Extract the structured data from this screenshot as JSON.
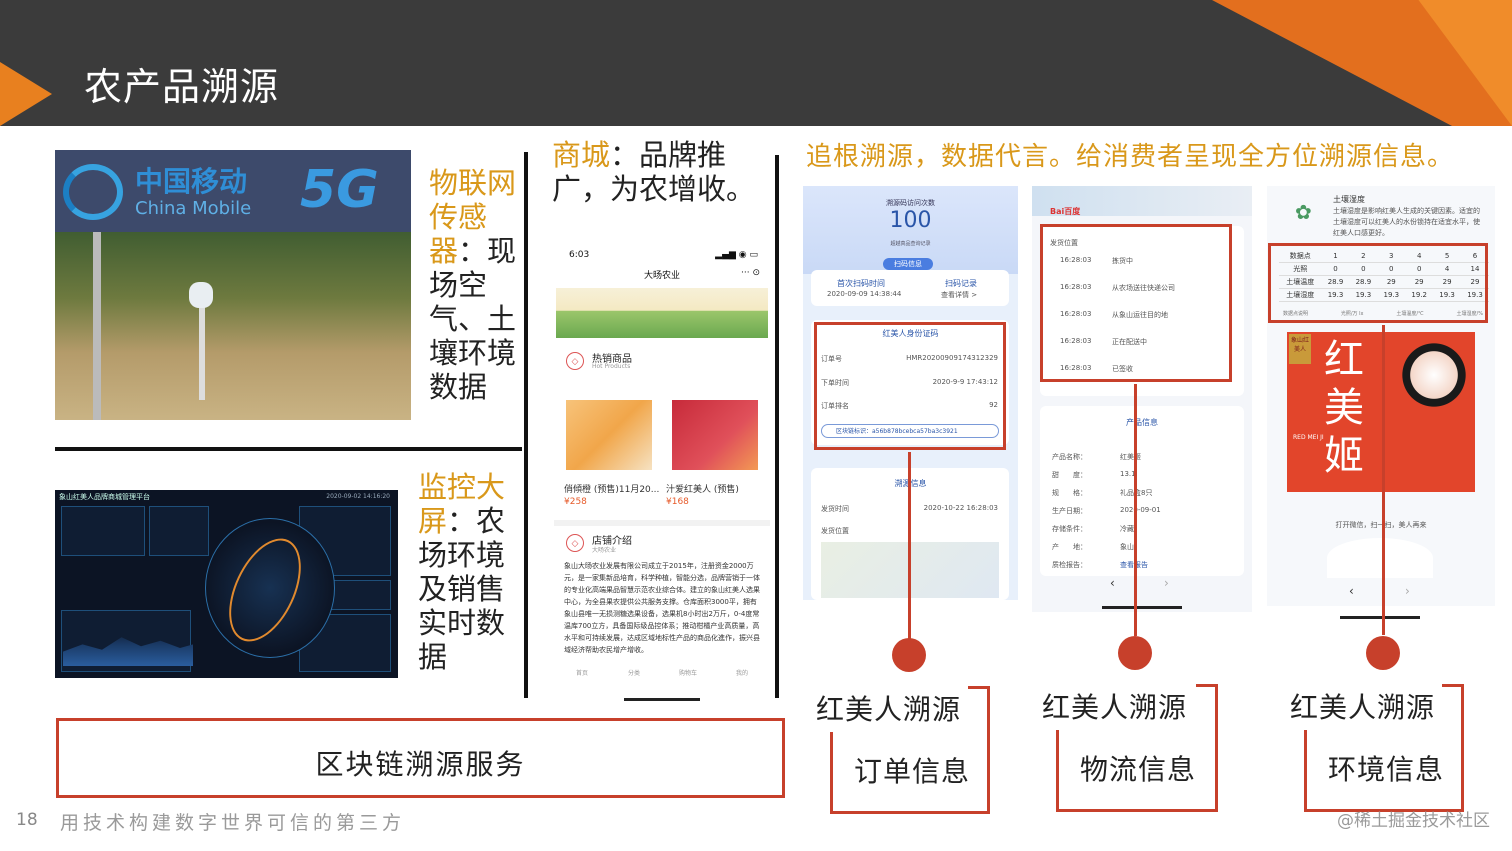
{
  "header": {
    "title": "农产品溯源"
  },
  "logo": {
    "cn": "中国移动",
    "en": "China Mobile",
    "badge": "5G"
  },
  "iot": {
    "highlight": "物联网传感器",
    "text": "：现场空气、土壤环境数据"
  },
  "monitor": {
    "highlight": "监控大屏",
    "text": "：农场环境及销售实时数据",
    "dashboard_title": "象山红美人品牌商城管理平台",
    "dashboard_time": "2020-09-02 14:16:20"
  },
  "mall": {
    "highlight": "商城",
    "text": "：品牌推广，为农增收。"
  },
  "phone": {
    "time": "6:03",
    "app_name": "大旸农业",
    "hot_title": "热销商品",
    "hot_sub": "Hot Products",
    "products": [
      {
        "name": "俏傾橙 (预售)11月20...",
        "price": "¥258"
      },
      {
        "name": "汁爱红美人 (预售)",
        "price": "¥168"
      }
    ],
    "shop_title": "店铺介绍",
    "shop_sub": "大旸农业",
    "shop_desc": "象山大旸农业发展有限公司成立于2015年，注册资金2000万元，是一家集新品培育，科学种植，智能分选，品牌营销于一体的专业化高端果品智慧示范农业综合体。建立的象山红美人选果中心，为全县果农提供公共服务支撑。仓库面积3000平，拥有象山县唯一无损测糖选果设备，选果机8小时出2万斤，0-4度常温库700立方，具备国际级品控体系；推动柑橘产业高质量，高水平和可持续发展，达成区域地标性产品的商品化進作，振兴县域经济帮助农民增产增收。",
    "nav": [
      "首页",
      "分类",
      "购物车",
      "我的"
    ]
  },
  "tagline": "追根溯源，数据代言。给消费者呈现全方位溯源信息。",
  "shot1": {
    "scan_label": "溯源码访问次数",
    "scan_count": "100",
    "scan_note": "超越真品查询记录",
    "scan_info": "扫码信息",
    "first_scan_label": "首次扫码时间",
    "first_scan_time": "2020-09-09 14:38:44",
    "record_label": "扫码记录",
    "record_link": "查看详情 >",
    "cert_title": "红美人身份证码",
    "rows": [
      {
        "k": "订单号",
        "v": "HMR20200909174312329"
      },
      {
        "k": "下单时间",
        "v": "2020-9-9 17:43:12"
      },
      {
        "k": "订单排名",
        "v": "92"
      }
    ],
    "chain": "区块链标识：a56b878bcebca57ba3c3921",
    "trace_title": "溯源信息",
    "ship_time_label": "发货时间",
    "ship_time": "2020-10-22 16:28:03",
    "ship_loc_label": "发货位置"
  },
  "shot2": {
    "loc_label": "发货位置",
    "events": [
      {
        "t": "16:28:03",
        "s": "拣货中"
      },
      {
        "t": "16:28:03",
        "s": "从农场送往快递公司"
      },
      {
        "t": "16:28:03",
        "s": "从象山运往目的地"
      },
      {
        "t": "16:28:03",
        "s": "正在配送中"
      },
      {
        "t": "16:28:03",
        "s": "已签收"
      }
    ],
    "product_title": "产品信息",
    "info": [
      {
        "k": "产品名称：",
        "v": "红美姬"
      },
      {
        "k": "甜　　度：",
        "v": "13.1"
      },
      {
        "k": "规　　格：",
        "v": "礼品盒8只"
      },
      {
        "k": "生产日期：",
        "v": "2020-09-01"
      },
      {
        "k": "存储条件：",
        "v": "冷藏"
      },
      {
        "k": "产　　地：",
        "v": "象山"
      },
      {
        "k": "质检报告：",
        "v": "查看报告"
      }
    ]
  },
  "shot3": {
    "soil_title": "土壤湿度",
    "soil_desc": "土壤湿度是影响红美人生成的关键因素。适宜的土壤湿度可以红美人的水份锁持在适宜水平，使红美人口感更好。",
    "table_header": [
      "数据点",
      "1",
      "2",
      "3",
      "4",
      "5",
      "6"
    ],
    "table_rows": [
      [
        "光照",
        "0",
        "0",
        "0",
        "0",
        "4",
        "14"
      ],
      [
        "土壤温度",
        "28.9",
        "28.9",
        "29",
        "29",
        "29",
        "29"
      ],
      [
        "土壤湿度",
        "19.3",
        "19.3",
        "19.3",
        "19.2",
        "19.3",
        "19.3"
      ]
    ],
    "table_units": [
      "数据点说明",
      "光照/万 lx",
      "土壤温度/℃",
      "土壤湿度/%"
    ],
    "poster_big": "红美姬",
    "poster_brand": "RED MEI JI",
    "poster_badge": "象山红美人",
    "wechat": "打开微信，扫一扫，美人再来"
  },
  "labels": [
    {
      "top": "红美人溯源",
      "bottom": "订单信息"
    },
    {
      "top": "红美人溯源",
      "bottom": "物流信息"
    },
    {
      "top": "红美人溯源",
      "bottom": "环境信息"
    }
  ],
  "blockchain": "区块链溯源服务",
  "footer": {
    "page": "18",
    "slogan": "用技术构建数字世界可信的第三方",
    "watermark": "@稀土掘金技术社区"
  },
  "colors": {
    "accent_red": "#c7402b",
    "accent_gold": "#d9981a",
    "header_dark": "#3b3b3b",
    "header_orange": "#e36f1e"
  }
}
